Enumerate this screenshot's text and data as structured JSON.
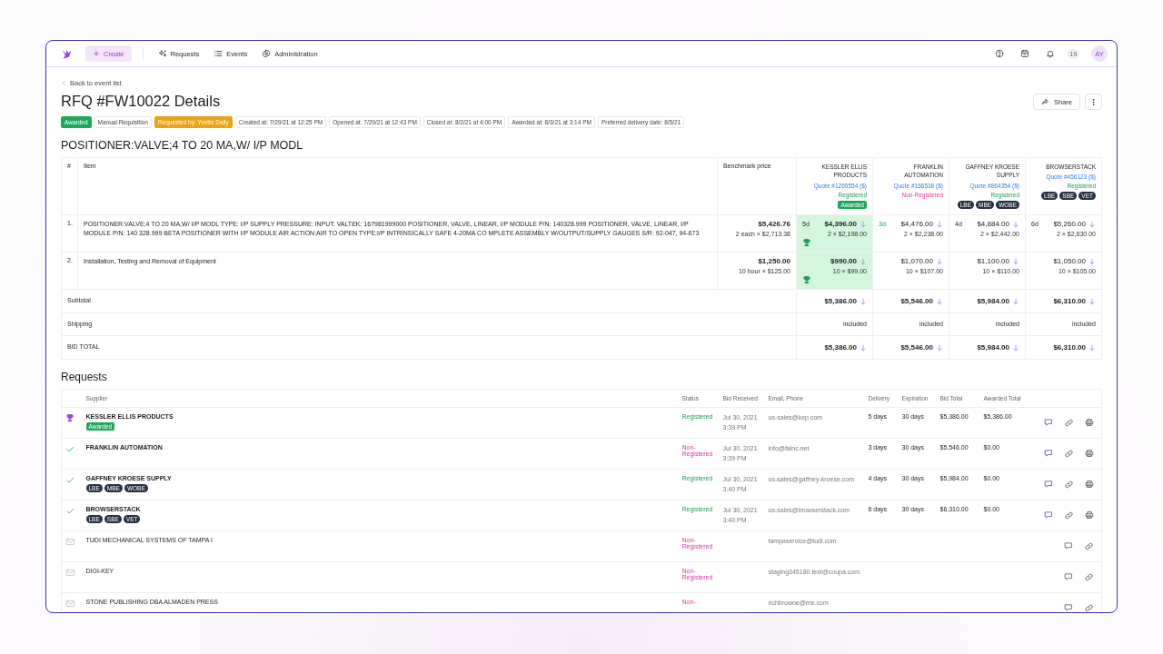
{
  "nav": {
    "create_label": "Create",
    "items": [
      {
        "label": "Requests",
        "kind": "requests"
      },
      {
        "label": "Events",
        "kind": "events"
      },
      {
        "label": "Administration",
        "kind": "administration"
      }
    ],
    "notification_count": "19",
    "avatar": "AY"
  },
  "back_link": "Back to event list",
  "title": "RFQ #FW10022 Details",
  "share_label": "Share",
  "tags": [
    {
      "label": "Awarded",
      "kind": "success"
    },
    {
      "label": "Manual Requisition",
      "kind": "plain"
    },
    {
      "label": "Requested by: Yvette Daily",
      "kind": "warning"
    },
    {
      "label": "Created at: 7/29/21 at 12:25 PM",
      "kind": "plain"
    },
    {
      "label": "Opened at: 7/29/21 at 12:43 PM",
      "kind": "plain"
    },
    {
      "label": "Closed at: 8/2/21 at 4:00 PM",
      "kind": "plain"
    },
    {
      "label": "Awarded at: 8/3/21 at 3:14 PM",
      "kind": "plain"
    },
    {
      "label": "Preferred delivery date: 8/5/21",
      "kind": "plain"
    }
  ],
  "section_title": "POSITIONER:VALVE;4 TO 20 MA,W/ I/P MODL",
  "comparison": {
    "columns": {
      "number": "#",
      "item": "Item",
      "benchmark": "Benchmark price"
    },
    "suppliers": [
      {
        "name": "KESSLER ELLIS PRODUCTS",
        "quote": "Quote #1265554 ($)",
        "status": "Registered",
        "registered": true,
        "badge": "Awarded"
      },
      {
        "name": "FRANKLIN AUTOMATION",
        "quote": "Quote #166538 ($)",
        "status": "Non-Registered",
        "registered": false
      },
      {
        "name": "GAFFNEY KROESE SUPPLY",
        "quote": "Quote #864354 ($)",
        "status": "Registered",
        "registered": true,
        "certifications": [
          "LBE",
          "MBE",
          "WOBE"
        ]
      },
      {
        "name": "BROWSERSTACK",
        "quote": "Quote #456123 ($)",
        "status": "Registered",
        "registered": true,
        "certifications": [
          "LBE",
          "SBE",
          "VET"
        ]
      }
    ],
    "lines": [
      {
        "number": "1.",
        "description": "POSITIONER:VALVE;4 TO 20 MA,W/ I/P MODL TYPE: I/P SUPPLY PRESSURE: INPUT: VALTEK: 167981999000 POSITIONER, VALVE, LINEAR, I/P MODULE P/N: 140328.999 POSITIONER, VALVE, LINEAR, I/P MODULE P/N: 140 328.999 BETA POSITIONER WITH I/P MODULE AIR ACTION:AIR TO OPEN TYPE:I/P INTRINSICALLY SAFE 4-20MA CO MPLETE ASSEMBLY W/OUTPUT/SUPPLY GAUGES S/R: 92-047, 94-673",
        "benchmark_total": "$5,426.76",
        "benchmark_detail": "2 each × $2,713.38",
        "bids": [
          {
            "lead_time": "5d",
            "fastest": false,
            "total": "$4,396.00",
            "detail": "2 × $2,198.00",
            "awarded": true
          },
          {
            "lead_time": "3d",
            "fastest": true,
            "total": "$4,476.00",
            "detail": "2 × $2,238.00",
            "awarded": false
          },
          {
            "lead_time": "4d",
            "fastest": false,
            "total": "$4,884.00",
            "detail": "2 × $2,442.00",
            "awarded": false
          },
          {
            "lead_time": "6d",
            "fastest": false,
            "total": "$5,260.00",
            "detail": "2 × $2,630.00",
            "awarded": false
          }
        ]
      },
      {
        "number": "2.",
        "description": "Installation, Testing and Removal of Equipment",
        "benchmark_total": "$1,250.00",
        "benchmark_detail": "10 hour × $125.00",
        "bids": [
          {
            "total": "$990.00",
            "detail": "10 × $99.00",
            "awarded": true
          },
          {
            "total": "$1,070.00",
            "detail": "10 × $107.00",
            "awarded": false
          },
          {
            "total": "$1,100.00",
            "detail": "10 × $110.00",
            "awarded": false
          },
          {
            "total": "$1,050.00",
            "detail": "10 × $105.00",
            "awarded": false
          }
        ]
      }
    ],
    "summary": [
      {
        "label": "Subtotal",
        "kind": "amount",
        "values": [
          "$5,386.00",
          "$5,546.00",
          "$5,984.00",
          "$6,310.00"
        ]
      },
      {
        "label": "Shipping",
        "kind": "note",
        "values": [
          "included",
          "included",
          "included",
          "included"
        ]
      },
      {
        "label": "BID TOTAL",
        "kind": "amount",
        "values": [
          "$5,386.00",
          "$5,546.00",
          "$5,984.00",
          "$6,310.00"
        ]
      }
    ]
  },
  "requests": {
    "title": "Requests",
    "columns": [
      "Supplier",
      "Status",
      "Bid Received",
      "Email, Phone",
      "Delivery",
      "Expiration",
      "Bid Total",
      "Awarded Total"
    ],
    "rows": [
      {
        "kind": "awarded",
        "supplier": "KESSLER ELLIS PRODUCTS",
        "badge": "Awarded",
        "status": "Registered",
        "registered": true,
        "bid_received": "Jul 30, 2021 3:39 PM",
        "email": "us-sales@kep.com",
        "delivery": "5 days",
        "expiration": "30 days",
        "bid_total": "$5,386.00",
        "awarded_total": "$5,386.00",
        "actions": [
          {
            "kind": "comment"
          },
          {
            "kind": "link"
          },
          {
            "kind": "print"
          }
        ]
      },
      {
        "kind": "bid",
        "supplier": "FRANKLIN AUTOMATION",
        "status": "Non-Registered",
        "registered": false,
        "bid_received": "Jul 30, 2021 3:39 PM",
        "email": "info@fainc.net",
        "delivery": "3 days",
        "expiration": "30 days",
        "bid_total": "$5,546.00",
        "awarded_total": "$0.00",
        "actions": [
          {
            "kind": "comment"
          },
          {
            "kind": "link"
          },
          {
            "kind": "print"
          }
        ]
      },
      {
        "kind": "bid",
        "supplier": "GAFFNEY KROESE SUPPLY",
        "certifications": [
          "LBE",
          "MBE",
          "WOBE"
        ],
        "status": "Registered",
        "registered": true,
        "bid_received": "Jul 30, 2021 3:40 PM",
        "email": "us-sales@gaffney-kroese.com",
        "delivery": "4 days",
        "expiration": "30 days",
        "bid_total": "$5,984.00",
        "awarded_total": "$0.00",
        "actions": [
          {
            "kind": "comment"
          },
          {
            "kind": "link"
          },
          {
            "kind": "print"
          }
        ]
      },
      {
        "kind": "bid",
        "supplier": "BROWSERSTACK",
        "certifications": [
          "LBE",
          "SBE",
          "VET"
        ],
        "status": "Registered",
        "registered": true,
        "bid_received": "Jul 30, 2021 3:40 PM",
        "email": "us-sales@browserstack.com",
        "delivery": "6 days",
        "expiration": "30 days",
        "bid_total": "$6,310.00",
        "awarded_total": "$0.00",
        "actions": [
          {
            "kind": "comment"
          },
          {
            "kind": "link"
          },
          {
            "kind": "print"
          }
        ]
      },
      {
        "kind": "invited",
        "supplier": "TUDI MECHANICAL SYSTEMS OF TAMPA I",
        "status": "Non-Registered",
        "registered": false,
        "email": "tampaservice@tudi.com",
        "actions": [
          {
            "kind": "comment"
          },
          {
            "kind": "link"
          }
        ]
      },
      {
        "kind": "invited",
        "supplier": "DIGI-KEY",
        "status": "Non-Registered",
        "registered": false,
        "email": "staging345180.test@coupa.com",
        "actions": [
          {
            "kind": "comment"
          },
          {
            "kind": "link"
          }
        ]
      },
      {
        "kind": "invited",
        "supplier": "STONE PUBLISHING DBA ALMADEN PRESS",
        "status": "Non-",
        "registered": false,
        "email": "richbrowne@me.com",
        "actions": [
          {
            "kind": "comment"
          },
          {
            "kind": "link"
          }
        ]
      }
    ]
  }
}
